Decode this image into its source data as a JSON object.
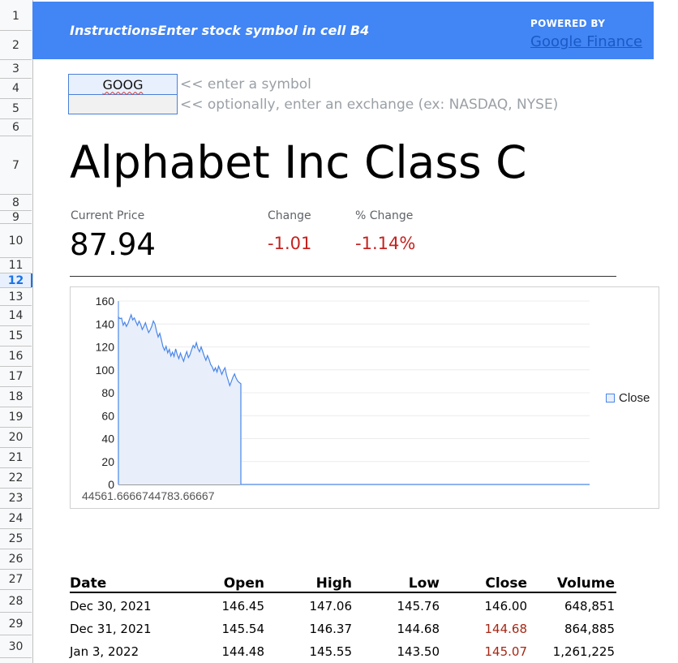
{
  "row_numbers": [
    "1",
    "2",
    "3",
    "4",
    "5",
    "6",
    "7",
    "8",
    "9",
    "10",
    "11",
    "12",
    "13",
    "14",
    "15",
    "16",
    "17",
    "18",
    "19",
    "20",
    "21",
    "22",
    "23",
    "24",
    "25",
    "26",
    "27",
    "28",
    "29",
    "30"
  ],
  "selected_row": "12",
  "banner": {
    "instructions": "InstructionsEnter stock symbol in cell B4",
    "powered_by": "POWERED BY",
    "link": "Google Finance",
    "color": "#4285f4"
  },
  "inputs": {
    "symbol": "GOOG",
    "exchange": "",
    "symbol_hint": "<< enter a symbol",
    "exchange_hint": "<< optionally, enter an exchange (ex: NASDAQ, NYSE)"
  },
  "company_name": "Alphabet Inc Class C",
  "quote": {
    "price_label": "Current Price",
    "price": "87.94",
    "change_label": "Change",
    "change": "-1.01",
    "pct_change_label": "% Change",
    "pct_change": "-1.14%",
    "negative_color": "#c5221f"
  },
  "chart_data": {
    "type": "area",
    "x_tick_labels": [
      "44561.6666744783.66667"
    ],
    "y_ticks": [
      "0",
      "20",
      "40",
      "60",
      "80",
      "100",
      "120",
      "140",
      "160"
    ],
    "ylim": [
      0,
      160
    ],
    "legend": "Close",
    "legend_position": "right",
    "grid": true,
    "series": [
      {
        "name": "Close",
        "color": "#4a86e8",
        "values": [
          146.0,
          144.7,
          145.1,
          139.0,
          141.5,
          137.9,
          140.3,
          144.2,
          148.0,
          143.6,
          145.3,
          141.9,
          138.8,
          142.5,
          139.6,
          135.2,
          138.0,
          141.1,
          136.4,
          132.5,
          134.9,
          138.1,
          142.6,
          139.8,
          133.4,
          128.7,
          131.9,
          126.5,
          120.3,
          117.0,
          120.6,
          114.8,
          117.9,
          112.1,
          115.5,
          111.7,
          118.3,
          113.2,
          109.8,
          114.6,
          111.0,
          107.5,
          112.4,
          115.9,
          110.7,
          113.1,
          117.4,
          121.3,
          119.2,
          123.7,
          118.5,
          115.8,
          120.0,
          116.1,
          111.9,
          108.3,
          112.5,
          109.1,
          104.8,
          102.6,
          99.0,
          101.7,
          98.1,
          103.2,
          100.0,
          96.1,
          99.4,
          101.8,
          95.3,
          91.0,
          86.2,
          89.7,
          93.5,
          96.4,
          92.8,
          90.3,
          88.9,
          87.94,
          0
        ]
      }
    ]
  },
  "table": {
    "headers": [
      "Date",
      "Open",
      "High",
      "Low",
      "Close",
      "Volume"
    ],
    "rows": [
      {
        "date": "Dec 30, 2021",
        "open": "146.45",
        "high": "147.06",
        "low": "145.76",
        "close": "146.00",
        "volume": "648,851",
        "close_down": false
      },
      {
        "date": "Dec 31, 2021",
        "open": "145.54",
        "high": "146.37",
        "low": "144.68",
        "close": "144.68",
        "volume": "864,885",
        "close_down": true
      },
      {
        "date": "Jan 3, 2022",
        "open": "144.48",
        "high": "145.55",
        "low": "143.50",
        "close": "145.07",
        "volume": "1,261,225",
        "close_down": true
      }
    ]
  }
}
